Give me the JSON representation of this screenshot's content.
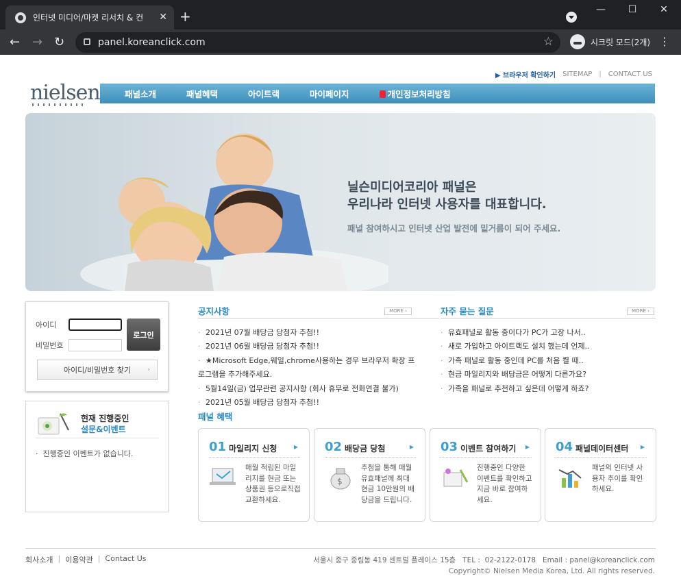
{
  "browser": {
    "tab_title": "인터넷 미디어/마켓 리서치 & 컨",
    "url": "panel.koreanclick.com",
    "incognito_label": "시크릿 모드(2개)"
  },
  "header": {
    "logo": "nielsen",
    "toplinks": [
      "▶ 브라우저 확인하기",
      "SITEMAP",
      "CONTACT US"
    ],
    "nav": [
      "패널소개",
      "패널혜택",
      "아이트랙",
      "마이페이지",
      "개인정보처리방침"
    ]
  },
  "hero": {
    "headline_1": "닐슨미디어코리아 패널은",
    "headline_2": "우리나라 인터넷 사용자를 대표합니다.",
    "subtext": "패널 참여하시고 인터넷 산업 발전에 밑거름이 되어 주세요."
  },
  "login": {
    "id_label": "아이디",
    "pw_label": "비밀번호",
    "login_button": "로그인",
    "find_button": "아이디/비밀번호 찾기"
  },
  "event": {
    "title_1": "현재 진행중인",
    "title_2": "설문&이벤트",
    "message": "진행중인 이벤트가 없습니다."
  },
  "notice": {
    "title": "공지사항",
    "more": "MORE",
    "items": [
      "2021년 07월 배당금 당첨자 추첨!!",
      "2021년 06월 배당금 당첨자 추첨!!",
      "★Microsoft Edge,웨일,chrome사용하는 경우 브라우저 확장 프",
      "로그램을 추가해주세요.",
      "5월14일(금) 업무관련 공지사항 (회사 휴무로 전화연결 불가)",
      "2021년 05월 배당금 당첨자 추첨!!"
    ]
  },
  "faq": {
    "title": "자주 묻는 질문",
    "more": "MORE",
    "items": [
      "유효패널로 활동 중이다가 PC가 고장 나서..",
      "새로 가입하고 아이트랙도 설치 했는데 언제..",
      "가족 패널로 활동 중인데 PC를 처음 켤 때..",
      "현금 마일리지와 배당금은 어떻게 다른가요?",
      "가족을 패널로 추천하고 싶은데 어떻게 하죠?"
    ]
  },
  "benefits": {
    "title": "패널 혜택",
    "cards": [
      {
        "num": "01",
        "name": "마일리지 신청",
        "desc": "매월 적립된 마일리지를 현금 또는 상품권 등으로직접 교환하세요."
      },
      {
        "num": "02",
        "name": "배당금 당첨",
        "desc": "추첨을 통해 매월 유효패널께 최대 현금 10만원의 배당금을 드립니다."
      },
      {
        "num": "03",
        "name": "이벤트 참여하기",
        "desc": "진행중인 다양한 이벤트를 확인하고 지금 바로 참여하세요."
      },
      {
        "num": "04",
        "name": "패널데이터센터",
        "desc": "패널의 인터넷 사용자 추이를 확인하세요."
      }
    ]
  },
  "footer": {
    "links": [
      "회사소개",
      "|",
      "이용약관",
      "|",
      "Contact Us"
    ],
    "address": "서울시 중구 중림동 419 센트럴 플레이스 15층   TEL :  02-2122-0178   Email : panel@koreanclick.com",
    "copyright": "Copyright© Nielsen Media Korea, Ltd. All rights reserved."
  },
  "colors": {
    "accent": "#2a8ac4",
    "nav_bar": "#4f9fc9",
    "browser_dark": "#202124"
  }
}
